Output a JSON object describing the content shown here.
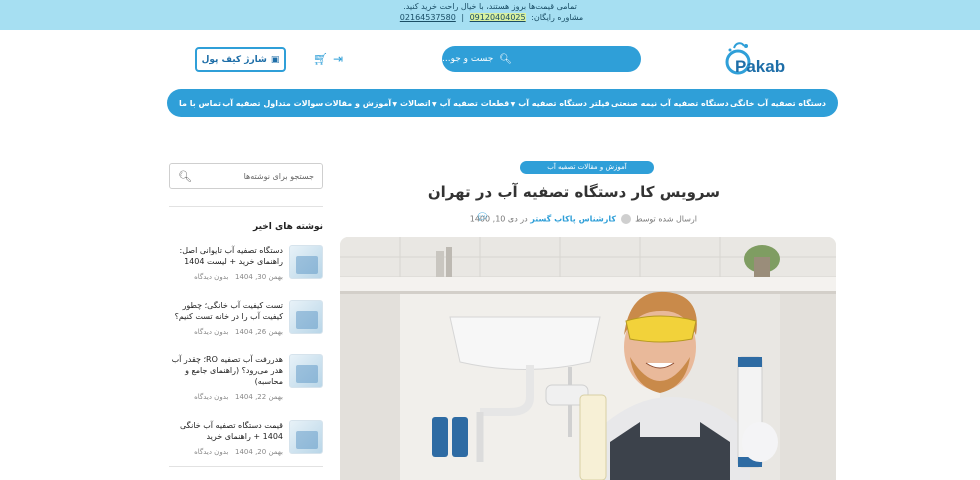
{
  "topbar": {
    "line1": "تمامی قیمت‌ها بروز هستند، با خیال راحت خرید کنید.",
    "line2_label": "مشاوره رایگان:",
    "phone1": "09120404025",
    "phone2": "02164537580"
  },
  "header": {
    "logo_text": "Pakab",
    "search_placeholder": "جست و جو...",
    "wallet_label": "شارژ کیف پول"
  },
  "nav": {
    "items": [
      {
        "label": "دستگاه تصفیه آب خانگی",
        "has_caret": false
      },
      {
        "label": "دستگاه تصفیه آب نیمه صنعتی",
        "has_caret": false
      },
      {
        "label": "فیلتر دستگاه تصفیه آب",
        "has_caret": true
      },
      {
        "label": "قطعات تصفیه آب",
        "has_caret": true
      },
      {
        "label": "اتصالات",
        "has_caret": true
      },
      {
        "label": "آموزش و مقالات",
        "has_caret": false
      },
      {
        "label": "سوالات متداول تصفیه آب",
        "has_caret": false
      },
      {
        "label": "تماس با ما",
        "has_caret": false
      }
    ]
  },
  "sidebar": {
    "search_placeholder": "جستجو برای نوشته‌ها",
    "recent_title": "نوشته های اخیر",
    "posts": [
      {
        "title": "دستگاه تصفیه آب تایوانی اصل: راهنمای خرید + لیست 1404",
        "date": "بهمن 30, 1404",
        "views": "بدون دیدگاه"
      },
      {
        "title": "تست کیفیت آب خانگی؛ چطور کیفیت آب را در خانه تست کنیم؟",
        "date": "بهمن 26, 1404",
        "views": "بدون دیدگاه"
      },
      {
        "title": "هدررفت آب تصفیه RO؛ چقدر آب هدر می‌رود؟ (راهنمای جامع و محاسبه)",
        "date": "بهمن 22, 1404",
        "views": "بدون دیدگاه"
      },
      {
        "title": "قیمت دستگاه تصفیه آب خانگی 1404 + راهنمای خرید",
        "date": "بهمن 20, 1404",
        "views": "بدون دیدگاه"
      }
    ]
  },
  "article": {
    "category": "آموزش و مقالات تصفیه آب",
    "title": "سرویس کار دستگاه تصفیه آب در تهران",
    "posted_by": "ارسال شده توسط",
    "author": "کارشناس پاکاب گستر",
    "date": "در دی 10, 1400"
  },
  "colors": {
    "accent": "#2f9fd8",
    "topbar": "#a6dff2",
    "brand_dark": "#1e6ea8"
  }
}
